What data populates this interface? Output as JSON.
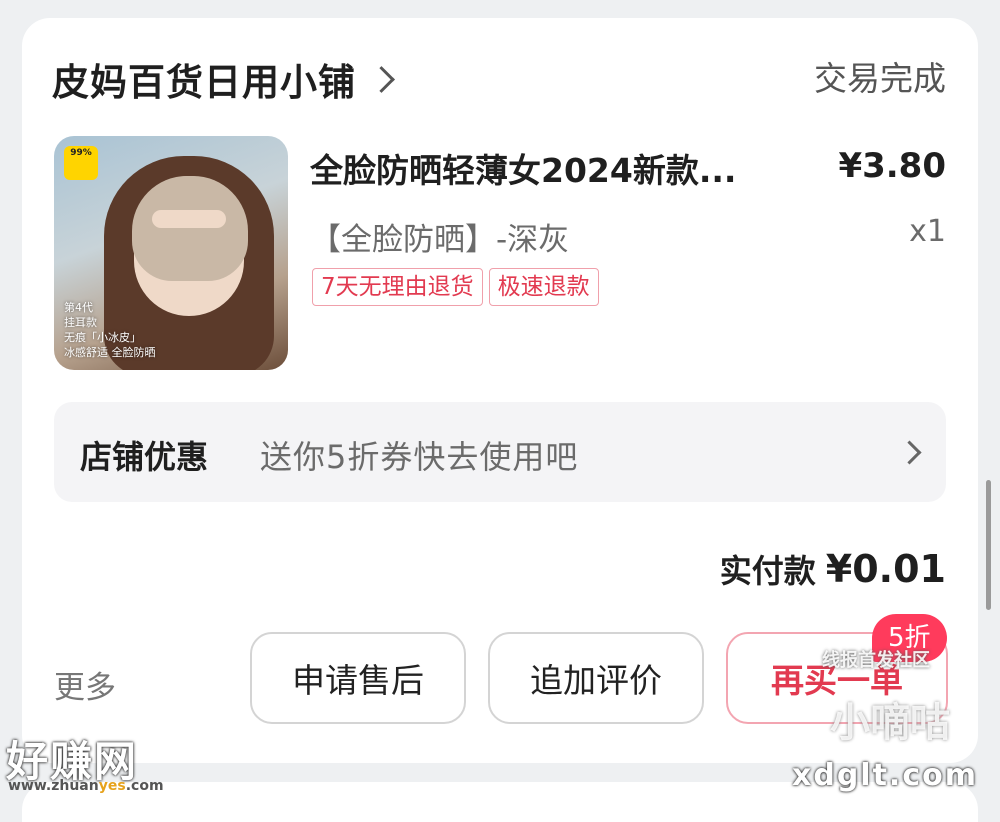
{
  "store": {
    "name": "皮妈百货日用小铺",
    "status": "交易完成"
  },
  "product": {
    "title": "全脸防晒轻薄女2024新款...",
    "price": "¥3.80",
    "variant": "【全脸防晒】-深灰",
    "quantity": "x1",
    "tags": [
      "7天无理由退货",
      "极速退款"
    ],
    "thumbnail": {
      "badge_text": "99%",
      "caption": [
        "第4代",
        "挂耳款",
        "无痕「小冰皮」",
        "冰感舒适 全脸防晒"
      ]
    }
  },
  "promo": {
    "label": "店铺优惠",
    "text": "送你5折券快去使用吧"
  },
  "payment": {
    "label": "实付款",
    "amount": "¥0.01"
  },
  "actions": {
    "more": "更多",
    "after_sales": "申请售后",
    "add_review": "追加评价",
    "buy_again": "再买一单",
    "buy_again_badge": "5折"
  },
  "watermarks": {
    "site1": "好赚网",
    "site1_url_a": "www.zhuan",
    "site1_url_b": "yes",
    "site1_url_c": ".com",
    "site2_tagline": "线报首发社区",
    "site2_name": "小嘀咕",
    "site2_url": "xdglt.com"
  },
  "colors": {
    "accent": "#e23a50",
    "badge": "#ff3b5c",
    "tag_border": "#f0a0ab"
  }
}
